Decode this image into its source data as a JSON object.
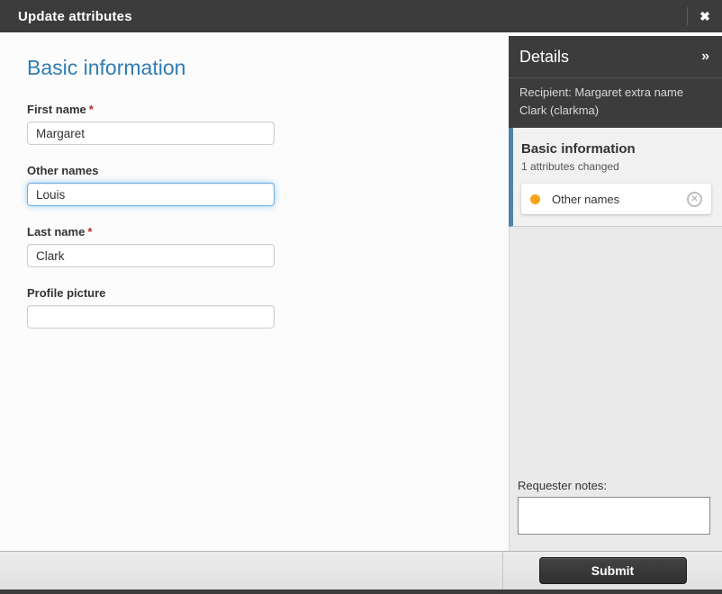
{
  "titlebar": {
    "title": "Update attributes",
    "close_icon": "✖"
  },
  "form": {
    "heading": "Basic information",
    "required_marker": "*",
    "fields": [
      {
        "label": "First name",
        "value": "Margaret",
        "required": true,
        "focused": false
      },
      {
        "label": "Other names",
        "value": "Louis",
        "required": false,
        "focused": true
      },
      {
        "label": "Last name",
        "value": "Clark",
        "required": true,
        "focused": false
      },
      {
        "label": "Profile picture",
        "value": "",
        "required": false,
        "focused": false
      }
    ]
  },
  "details": {
    "title": "Details",
    "collapse_icon": "»",
    "recipient": "Recipient: Margaret extra name Clark (clarkma)",
    "changes": {
      "heading": "Basic information",
      "summary": "1 attributes changed",
      "items": [
        {
          "label": "Other names",
          "dot_color": "#f7a41b",
          "remove_icon": "circle-x-icon"
        }
      ]
    },
    "notes": {
      "label": "Requester notes:",
      "value": ""
    }
  },
  "footer": {
    "submit_label": "Submit"
  },
  "colors": {
    "titlebar_bg": "#3c3c3c",
    "heading_blue": "#2e7cb5",
    "focus_blue": "#66afe9",
    "accent_bar_blue": "#4e84ab",
    "changed_dot_orange": "#f7a41b",
    "sidebar_bg": "#e9e9e9"
  }
}
